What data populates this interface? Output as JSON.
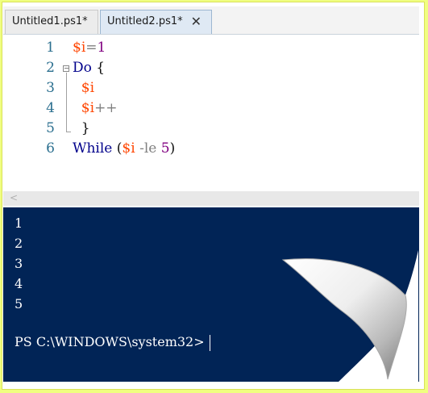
{
  "tabs": [
    {
      "label": "Untitled1.ps1*",
      "active": false
    },
    {
      "label": "Untitled2.ps1*",
      "active": true
    }
  ],
  "tab_close_icon": "close-icon",
  "editor": {
    "line_numbers": [
      "1",
      "2",
      "3",
      "4",
      "5",
      "6"
    ],
    "lines": [
      {
        "tokens": [
          {
            "t": "$i",
            "k": "var"
          },
          {
            "t": "=",
            "k": "op"
          },
          {
            "t": "1",
            "k": "num"
          }
        ]
      },
      {
        "tokens": [
          {
            "t": "Do",
            "k": "kw"
          },
          {
            "t": " {",
            "k": "punct"
          }
        ]
      },
      {
        "tokens": [
          {
            "t": "  $i",
            "k": "var"
          }
        ]
      },
      {
        "tokens": [
          {
            "t": "  $i",
            "k": "var"
          },
          {
            "t": "++",
            "k": "op"
          }
        ]
      },
      {
        "tokens": [
          {
            "t": "  }",
            "k": "punct"
          }
        ]
      },
      {
        "tokens": [
          {
            "t": "While",
            "k": "kw"
          },
          {
            "t": " (",
            "k": "punct"
          },
          {
            "t": "$i",
            "k": "var"
          },
          {
            "t": " -le ",
            "k": "op"
          },
          {
            "t": "5",
            "k": "num"
          },
          {
            "t": ")",
            "k": "punct"
          }
        ]
      }
    ]
  },
  "scroll_arrow": "<",
  "console": {
    "output": [
      "1",
      "2",
      "3",
      "4",
      "5"
    ],
    "prompt": "PS C:\\WINDOWS\\system32>"
  },
  "colors": {
    "console_bg": "#012456",
    "variable": "#ff4500",
    "keyword": "#00008b",
    "number": "#800080",
    "operator": "#808080",
    "line_number": "#2b6f8f"
  }
}
